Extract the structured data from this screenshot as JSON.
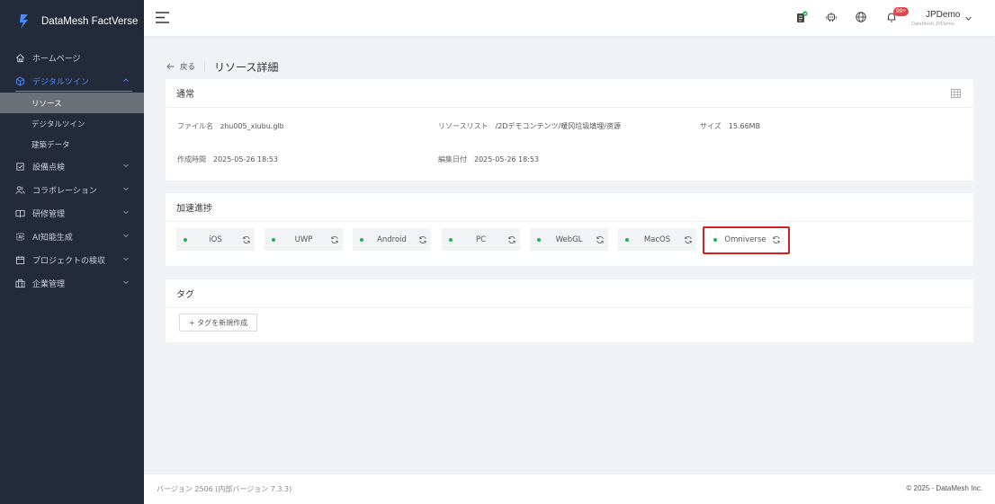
{
  "brand": {
    "name": "DataMesh FactVerse"
  },
  "sidebar": {
    "items": [
      {
        "label": "ホームページ",
        "icon": "home-icon"
      },
      {
        "label": "デジタルツイン",
        "icon": "cube-icon",
        "active": true,
        "children": [
          {
            "label": "リソース",
            "selected": true
          },
          {
            "label": "デジタルツイン"
          },
          {
            "label": "建築データ"
          }
        ]
      },
      {
        "label": "設備点検",
        "icon": "checklist-icon"
      },
      {
        "label": "コラボレーション",
        "icon": "users-icon"
      },
      {
        "label": "研修管理",
        "icon": "book-icon"
      },
      {
        "label": "AI知能生成",
        "icon": "ai-icon"
      },
      {
        "label": "プロジェクトの検収",
        "icon": "calendar-icon"
      },
      {
        "label": "企業管理",
        "icon": "building-icon"
      }
    ]
  },
  "header": {
    "notification_count": "99+",
    "user": {
      "name": "JPDemo",
      "sub": "DataMesh.JPDemo"
    }
  },
  "page": {
    "back_label": "戻る",
    "title": "リソース詳細"
  },
  "general": {
    "title": "通常",
    "file_name_label": "ファイル名",
    "file_name": "zhu005_xiubu.glb",
    "resource_list_label": "リソースリスト",
    "resource_list": "/2Dデモコンテンツ/暖冈垃圾填埋/资源",
    "size_label": "サイズ",
    "size": "15.66MB",
    "created_label": "作成時間",
    "created": "2025-05-26 18:53",
    "edited_label": "編集日付",
    "edited": "2025-05-26 18:53"
  },
  "progress": {
    "title": "加速進捗",
    "platforms": [
      "iOS",
      "UWP",
      "Android",
      "PC",
      "WebGL",
      "MacOS",
      "Omniverse"
    ],
    "status_color": "#23b14d"
  },
  "tags": {
    "title": "タグ",
    "add_label": "+ タグを新規作成"
  },
  "footer": {
    "version": "バージョン 2506 (内部バージョン 7.3.3)",
    "copyright": "© 2025 - DataMesh Inc."
  },
  "colors": {
    "sidebar_bg": "#232a3a",
    "accent": "#4a8cf7",
    "highlight": "#d32020"
  }
}
